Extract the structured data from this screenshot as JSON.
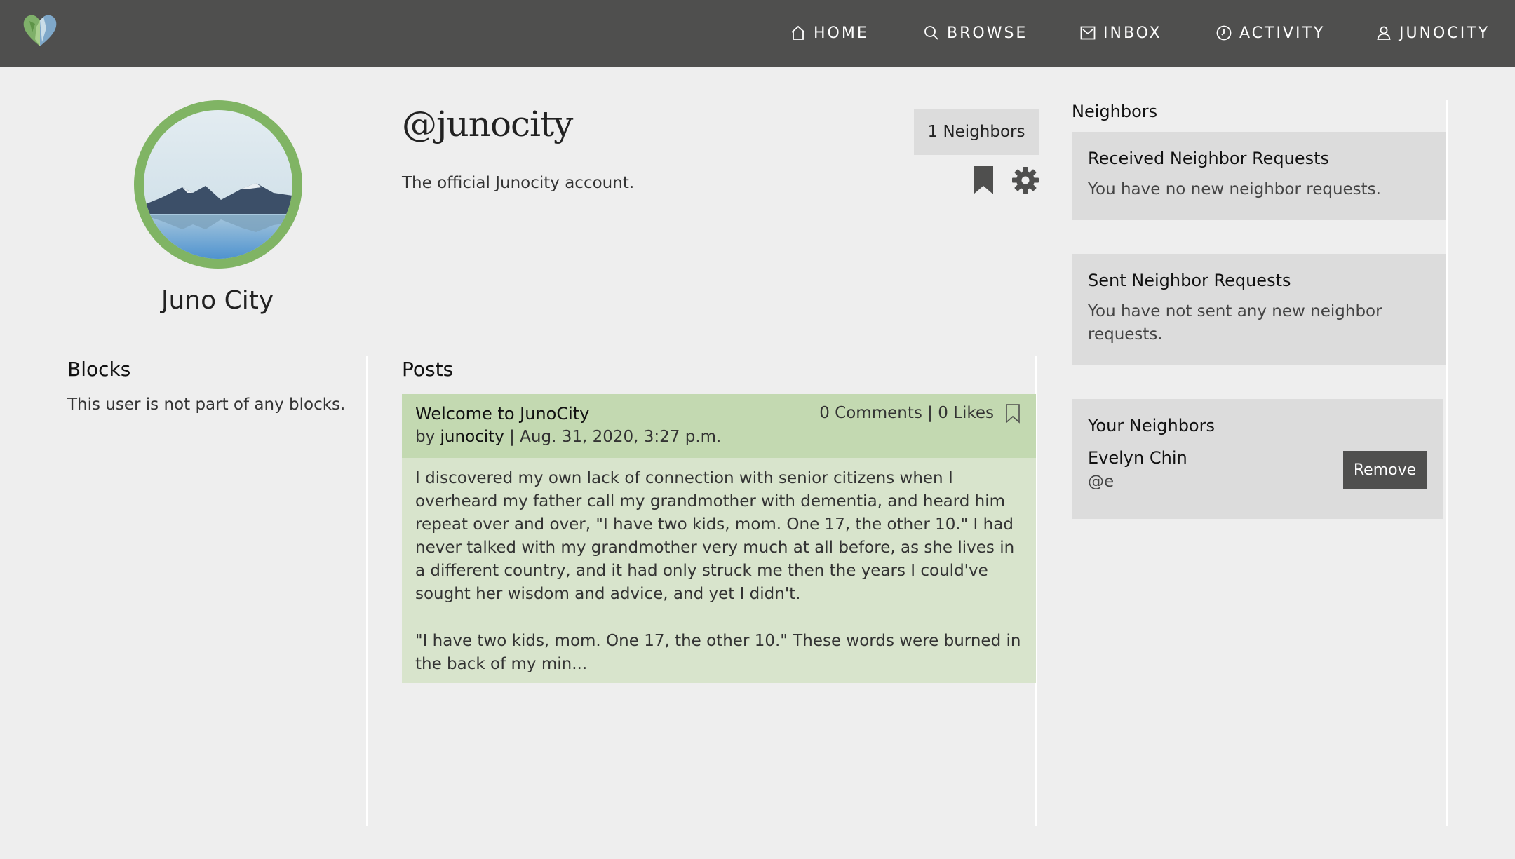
{
  "nav": {
    "items": [
      {
        "label": "HOME",
        "icon": "home-icon"
      },
      {
        "label": "BROWSE",
        "icon": "search-icon"
      },
      {
        "label": "INBOX",
        "icon": "inbox-icon"
      },
      {
        "label": "ACTIVITY",
        "icon": "clock-icon"
      },
      {
        "label": "JUNOCITY",
        "icon": "user-icon"
      }
    ]
  },
  "colors": {
    "topbar": "#4f4f4e",
    "avatar_ring": "#80b464",
    "post_header": "#c3d9b1",
    "post_body": "#d8e4cc",
    "card": "#dcdcdc"
  },
  "profile": {
    "display_name": "Juno City",
    "handle": "@junocity",
    "bio": "The official Junocity account.",
    "neighbors_button": "1 Neighbors"
  },
  "blocks": {
    "heading": "Blocks",
    "text": "This user is not part of any blocks."
  },
  "posts": {
    "heading": "Posts",
    "items": [
      {
        "title": "Welcome to JunoCity",
        "by": "by",
        "author": "junocity",
        "date": "| Aug. 31, 2020, 3:27 p.m.",
        "stats": "0 Comments | 0 Likes",
        "paragraph1": "I discovered my own lack of connection with senior citizens when I overheard my father call my grandmother with dementia, and heard him repeat over and over, \"I have two kids, mom. One 17, the other 10.\" I had never talked with my grandmother very much at all before, as she lives in a different country, and it had only struck me then the years I could've sought her wisdom and advice, and yet I didn't.",
        "paragraph2": "\"I have two kids, mom. One 17, the other 10.\" These words were burned in the back of my min..."
      }
    ]
  },
  "sidebar": {
    "heading": "Neighbors",
    "received": {
      "title": "Received Neighbor Requests",
      "text": "You have no new neighbor requests."
    },
    "sent": {
      "title": "Sent Neighbor Requests",
      "text": "You have not sent any new neighbor requests."
    },
    "yours": {
      "title": "Your Neighbors",
      "neighbors": [
        {
          "name": "Evelyn Chin",
          "handle": "@e",
          "remove_label": "Remove"
        }
      ]
    }
  }
}
